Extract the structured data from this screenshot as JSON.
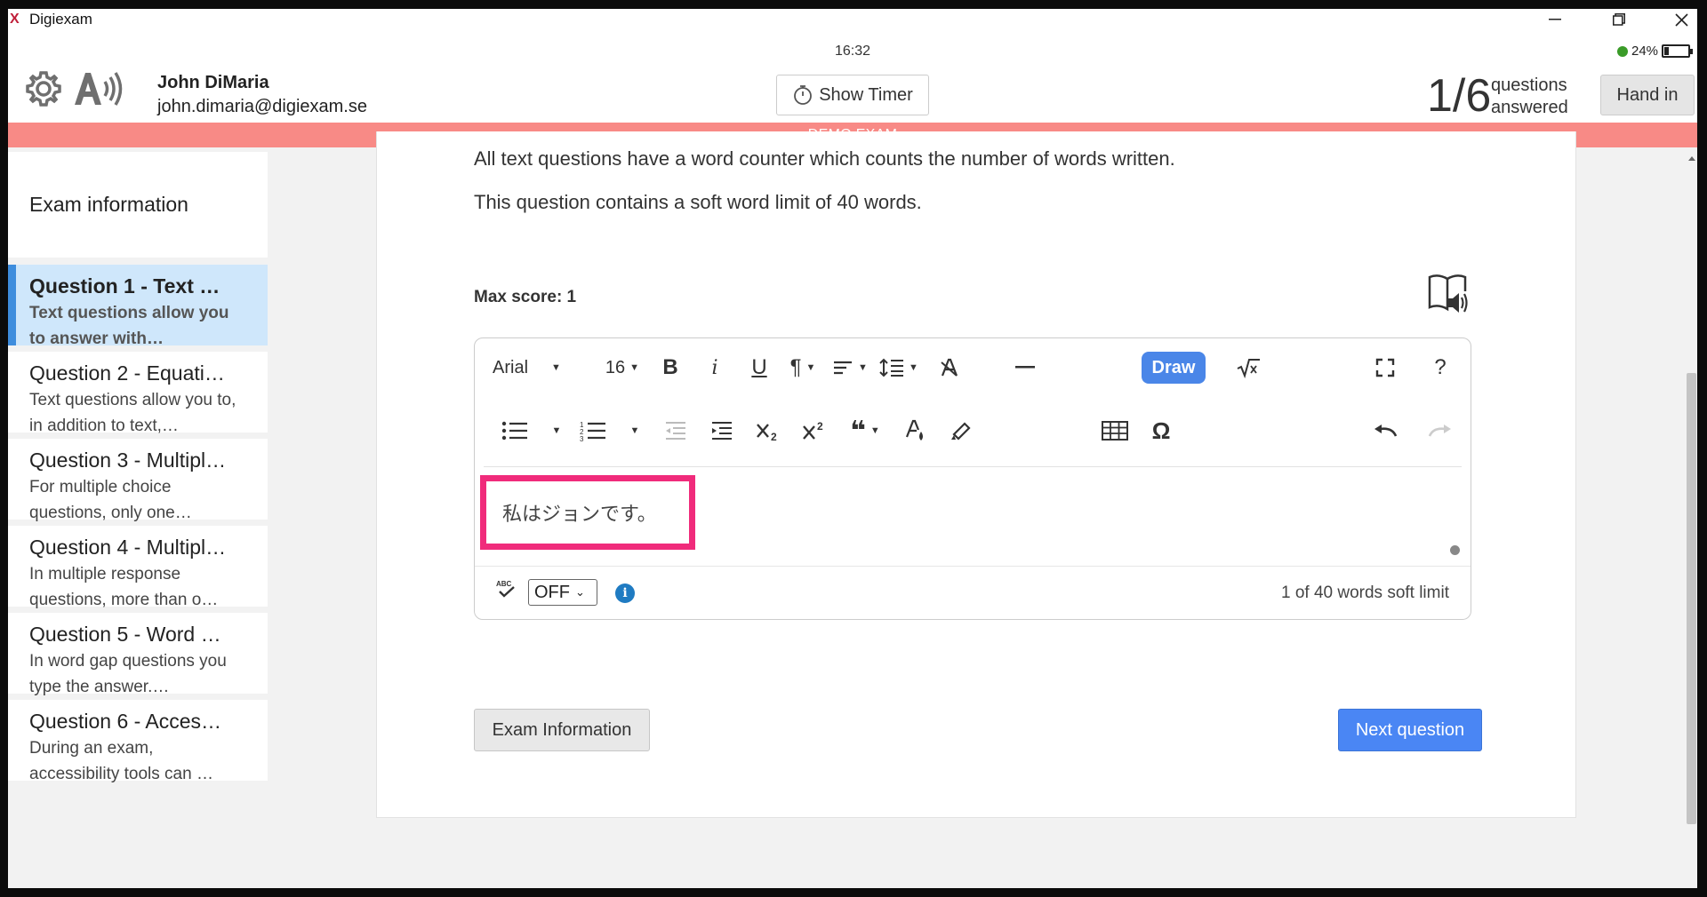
{
  "window": {
    "title": "Digiexam",
    "app_icon": "X",
    "controls": [
      "minimize",
      "maximize",
      "close"
    ]
  },
  "status": {
    "time": "16:32",
    "battery": "24%"
  },
  "header": {
    "user_name": "John DiMaria",
    "user_email": "john.dimaria@digiexam.se",
    "timer_label": "Show Timer",
    "progress_count": "1/6",
    "progress_label_1": "questions",
    "progress_label_2": "answered",
    "hand_in_label": "Hand in"
  },
  "banner": "DEMO EXAM",
  "sidebar": {
    "info_label": "Exam information",
    "items": [
      {
        "title": "Question 1 - Text …",
        "sub": "Text questions allow you to answer with…",
        "active": true
      },
      {
        "title": "Question 2 - Equati…",
        "sub": "Text questions allow you to, in addition to text,…"
      },
      {
        "title": "Question 3 - Multipl…",
        "sub": "For multiple choice questions, only one…"
      },
      {
        "title": "Question 4 - Multipl…",
        "sub": "In multiple response questions, more than o…"
      },
      {
        "title": "Question 5 - Word …",
        "sub": "In word gap questions you type the answer.…"
      },
      {
        "title": "Question 6 - Acces…",
        "sub": "During an exam, accessibility tools can …"
      }
    ]
  },
  "question": {
    "line_1": "All text questions have a word counter which counts the number of words written.",
    "line_2": "This question contains a soft word limit of 40 words.",
    "max_score": "Max score: 1"
  },
  "editor": {
    "font_family": "Arial",
    "font_size": "16",
    "draw_label": "Draw",
    "content": "私はジョンです。",
    "spellcheck_value": "OFF",
    "info_glyph": "i",
    "word_count": "1 of 40 words soft limit"
  },
  "buttons": {
    "exam_info": "Exam Information",
    "next": "Next question"
  },
  "colors": {
    "accent": "#4a86f4",
    "banner": "#f88a86",
    "active_item": "#cfe7fb",
    "highlight_box": "#f02b7b"
  }
}
